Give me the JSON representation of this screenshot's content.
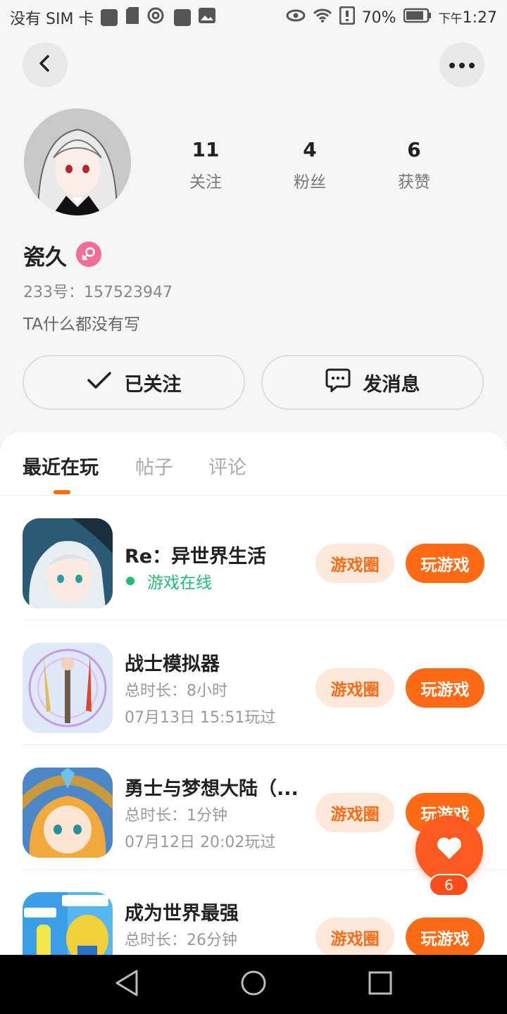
{
  "status_bar": {
    "carrier": "没有 SIM 卡",
    "battery": "70%",
    "time_prefix": "下午",
    "time": "1:27"
  },
  "profile": {
    "nickname": "瓷久",
    "uid": "233号：157523947",
    "bio": "TA什么都没有写",
    "stats": [
      {
        "num": "11",
        "label": "关注"
      },
      {
        "num": "4",
        "label": "粉丝"
      },
      {
        "num": "6",
        "label": "获赞"
      }
    ],
    "gender_color": "#f16d9a"
  },
  "actions": {
    "follow_label": "已关注",
    "message_label": "发消息"
  },
  "tabs": [
    {
      "label": "最近在玩",
      "active": true
    },
    {
      "label": "帖子",
      "active": false
    },
    {
      "label": "评论",
      "active": false
    }
  ],
  "games": [
    {
      "name": "Re：异世界生活",
      "status": "游戏在线"
    },
    {
      "name": "战士模拟器",
      "duration": "总时长：8小时",
      "last_played": "07月13日 15:51玩过"
    },
    {
      "name": "勇士与梦想大陆（...",
      "duration": "总时长：1分钟",
      "last_played": "07月12日 20:02玩过"
    },
    {
      "name": "成为世界最强",
      "duration": "总时长：26分钟",
      "last_played": ""
    }
  ],
  "buttons": {
    "circle_label": "游戏圈",
    "play_label": "玩游戏"
  },
  "like_fab": {
    "count": "6"
  },
  "colors": {
    "accent": "#ff6a14",
    "online": "#1fbf73",
    "circle_bg": "#fde8d9"
  }
}
